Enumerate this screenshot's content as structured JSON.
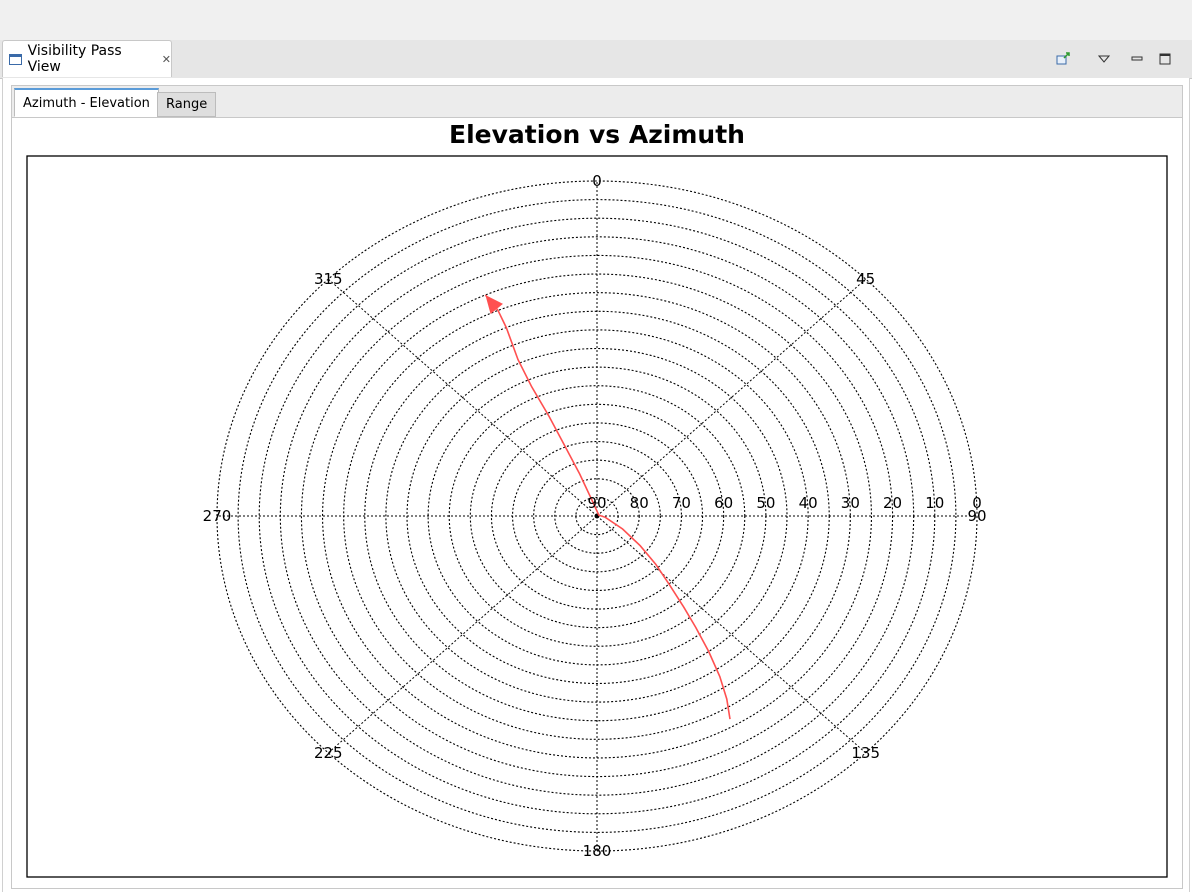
{
  "view": {
    "tab_label": "Visibility Pass View",
    "toolbar_icons": [
      "pin-icon",
      "view-menu-icon",
      "minimize-icon",
      "maximize-icon"
    ]
  },
  "subtabs": [
    {
      "label": "Azimuth - Elevation",
      "active": true
    },
    {
      "label": "Range",
      "active": false
    }
  ],
  "chart_data": {
    "type": "polar-line",
    "title": "Elevation vs Azimuth",
    "azimuth_ticks": [
      "0",
      "45",
      "90",
      "135",
      "180",
      "225",
      "270",
      "315"
    ],
    "elevation_ticks": [
      "0",
      "10",
      "20",
      "30",
      "40",
      "50",
      "60",
      "70",
      "80",
      "90"
    ],
    "elevation_range": [
      0,
      90
    ],
    "elevation_ring_step": 5,
    "grid": true,
    "series": [
      {
        "color": "#ff5050",
        "direction_arrow": "end",
        "points": [
          {
            "azimuth": 150,
            "elevation": 27
          },
          {
            "azimuth": 148,
            "elevation": 32
          },
          {
            "azimuth": 146,
            "elevation": 38
          },
          {
            "azimuth": 144,
            "elevation": 45
          },
          {
            "azimuth": 142,
            "elevation": 52
          },
          {
            "azimuth": 140,
            "elevation": 58
          },
          {
            "azimuth": 137,
            "elevation": 65
          },
          {
            "azimuth": 133,
            "elevation": 71
          },
          {
            "azimuth": 128,
            "elevation": 77
          },
          {
            "azimuth": 120,
            "elevation": 83
          },
          {
            "azimuth": 100,
            "elevation": 88
          },
          {
            "azimuth": 60,
            "elevation": 89.5
          },
          {
            "azimuth": 345,
            "elevation": 86
          },
          {
            "azimuth": 340,
            "elevation": 78
          },
          {
            "azimuth": 338,
            "elevation": 70
          },
          {
            "azimuth": 337,
            "elevation": 61
          },
          {
            "azimuth": 336,
            "elevation": 52
          },
          {
            "azimuth": 336,
            "elevation": 44
          },
          {
            "azimuth": 337,
            "elevation": 35
          },
          {
            "azimuth": 337,
            "elevation": 30
          },
          {
            "azimuth": 336,
            "elevation": 25
          }
        ]
      }
    ]
  }
}
